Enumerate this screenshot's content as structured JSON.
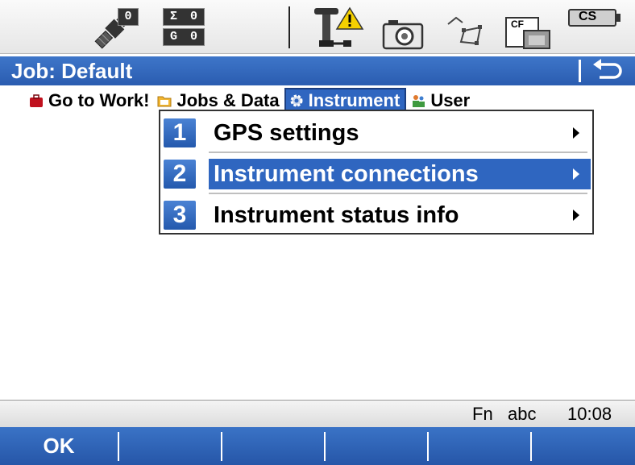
{
  "status_bar": {
    "satellite_count": "0",
    "sigma_label": "Σ",
    "sigma_value": "0",
    "g_label": "G",
    "g_value": "0",
    "battery_label": "CS",
    "cf_label": "CF",
    "icons": [
      "satellite-icon",
      "sigma-counter-icon",
      "gps-antenna-warning-icon",
      "camera-icon",
      "linework-icon",
      "cf-card-icon",
      "battery-icon"
    ]
  },
  "title_bar": {
    "title": "Job: Default",
    "back_icon": "back-arrow-icon"
  },
  "tabs": [
    {
      "label": "Go to Work!",
      "icon": "briefcase-icon",
      "color": "#c0111e"
    },
    {
      "label": "Jobs & Data",
      "icon": "folder-icon",
      "color": "#f2b632"
    },
    {
      "label": "Instrument",
      "icon": "gear-icon",
      "color": "#9ab5d8",
      "selected": true
    },
    {
      "label": "User",
      "icon": "user-icon",
      "color": "#3f9a3f"
    }
  ],
  "menu": {
    "items": [
      {
        "number": "1",
        "label": "GPS settings"
      },
      {
        "number": "2",
        "label": "Instrument connections",
        "selected": true
      },
      {
        "number": "3",
        "label": "Instrument status info"
      }
    ]
  },
  "bottom_status": {
    "fn": "Fn",
    "input_mode": "abc",
    "time": "10:08"
  },
  "softkeys": {
    "f1": "OK",
    "f2": "",
    "f3": "",
    "f4": "",
    "f5": "",
    "f6": ""
  },
  "colors": {
    "accent_blue": "#2f66c0",
    "title_blue": "#2a5cb0",
    "warning_yellow": "#f5d000"
  }
}
